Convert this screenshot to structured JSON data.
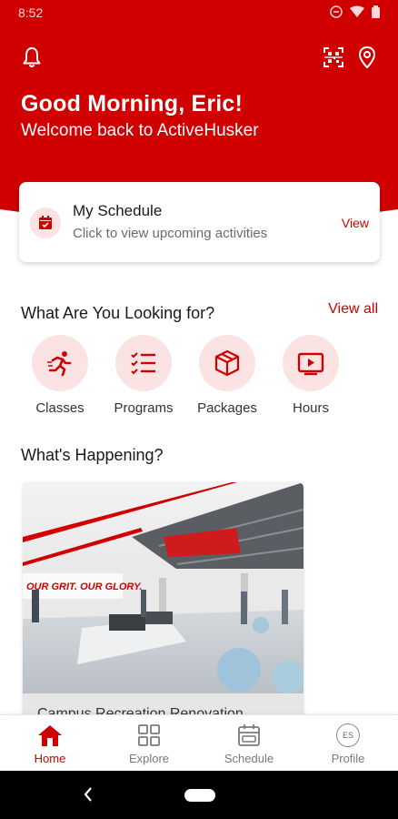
{
  "status_bar": {
    "time": "8:52"
  },
  "header": {
    "greeting": "Good Morning, Eric!",
    "welcome": "Welcome back to ActiveHusker",
    "icons": [
      "bell-icon",
      "qr-scan-icon",
      "location-pin-icon"
    ]
  },
  "schedule_card": {
    "title": "My Schedule",
    "subtitle": "Click to view upcoming activities",
    "action": "View",
    "icon": "calendar-check-icon"
  },
  "categories": {
    "title": "What Are You Looking for?",
    "view_all": "View all",
    "items": [
      {
        "label": "Classes",
        "icon": "running-icon"
      },
      {
        "label": "Programs",
        "icon": "checklist-icon"
      },
      {
        "label": "Packages",
        "icon": "box-icon"
      },
      {
        "label": "Hours",
        "icon": "play-video-icon"
      }
    ]
  },
  "happening": {
    "title": "What's Happening?",
    "card": {
      "caption": "Campus Recreation Renovation",
      "wall_text": "OUR GRIT. OUR GLORY."
    }
  },
  "bottom_nav": {
    "items": [
      {
        "label": "Home",
        "icon": "home-icon",
        "active": true
      },
      {
        "label": "Explore",
        "icon": "grid-icon",
        "active": false
      },
      {
        "label": "Schedule",
        "icon": "calendar-icon",
        "active": false
      },
      {
        "label": "Profile",
        "icon": "profile-avatar-icon",
        "initials": "ES",
        "active": false
      }
    ]
  },
  "colors": {
    "brand": "#d00000",
    "tint": "#fbe3e3"
  }
}
